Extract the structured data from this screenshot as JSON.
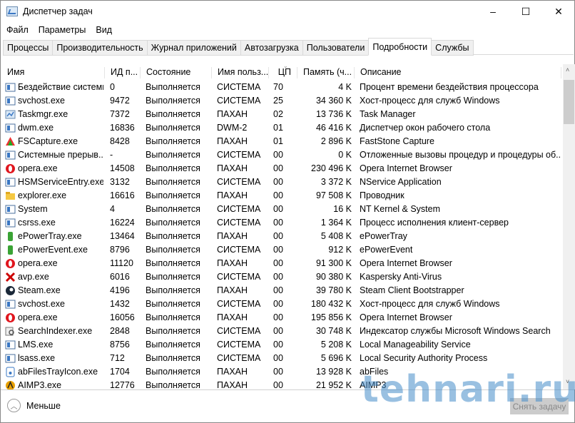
{
  "window": {
    "title": "Диспетчер задач",
    "minimize": "–",
    "maximize": "☐",
    "close": "✕"
  },
  "menu": [
    "Файл",
    "Параметры",
    "Вид"
  ],
  "tabs": [
    "Процессы",
    "Производительность",
    "Журнал приложений",
    "Автозагрузка",
    "Пользователи",
    "Подробности",
    "Службы"
  ],
  "active_tab": 5,
  "columns": [
    "Имя",
    "ИД п...",
    "Состояние",
    "Имя польз...",
    "ЦП",
    "Память (ч...",
    "Описание"
  ],
  "rows": [
    [
      "Бездействие системы",
      "0",
      "Выполняется",
      "СИСТЕМА",
      "70",
      "4 K",
      "Процент времени бездействия процессора",
      "win"
    ],
    [
      "svchost.exe",
      "9472",
      "Выполняется",
      "СИСТЕМА",
      "25",
      "34 360 K",
      "Хост-процесс для служб Windows",
      "win"
    ],
    [
      "Taskmgr.exe",
      "7372",
      "Выполняется",
      "ПАХАН",
      "02",
      "13 736 K",
      "Task Manager",
      "tm"
    ],
    [
      "dwm.exe",
      "16836",
      "Выполняется",
      "DWM-2",
      "01",
      "46 416 K",
      "Диспетчер окон рабочего стола",
      "win"
    ],
    [
      "FSCapture.exe",
      "8428",
      "Выполняется",
      "ПАХАН",
      "01",
      "2 896 K",
      "FastStone Capture",
      "fs"
    ],
    [
      "Системные прерыв...",
      "-",
      "Выполняется",
      "СИСТЕМА",
      "00",
      "0 K",
      "Отложенные вызовы процедур и процедуры об...",
      "win"
    ],
    [
      "opera.exe",
      "14508",
      "Выполняется",
      "ПАХАН",
      "00",
      "230 496 K",
      "Opera Internet Browser",
      "opera"
    ],
    [
      "HSMServiceEntry.exe",
      "3132",
      "Выполняется",
      "СИСТЕМА",
      "00",
      "3 372 K",
      "NService Application",
      "win"
    ],
    [
      "explorer.exe",
      "16616",
      "Выполняется",
      "ПАХАН",
      "00",
      "97 508 K",
      "Проводник",
      "folder"
    ],
    [
      "System",
      "4",
      "Выполняется",
      "СИСТЕМА",
      "00",
      "16 K",
      "NT Kernel & System",
      "win"
    ],
    [
      "csrss.exe",
      "16224",
      "Выполняется",
      "СИСТЕМА",
      "00",
      "1 364 K",
      "Процесс исполнения клиент-сервер",
      "win"
    ],
    [
      "ePowerTray.exe",
      "13464",
      "Выполняется",
      "ПАХАН",
      "00",
      "5 408 K",
      "ePowerTray",
      "green"
    ],
    [
      "ePowerEvent.exe",
      "8796",
      "Выполняется",
      "СИСТЕМА",
      "00",
      "912 K",
      "ePowerEvent",
      "green"
    ],
    [
      "opera.exe",
      "11120",
      "Выполняется",
      "ПАХАН",
      "00",
      "91 300 K",
      "Opera Internet Browser",
      "opera"
    ],
    [
      "avp.exe",
      "6016",
      "Выполняется",
      "СИСТЕМА",
      "00",
      "90 380 K",
      "Kaspersky Anti-Virus",
      "avp"
    ],
    [
      "Steam.exe",
      "4196",
      "Выполняется",
      "ПАХАН",
      "00",
      "39 780 K",
      "Steam Client Bootstrapper",
      "steam"
    ],
    [
      "svchost.exe",
      "1432",
      "Выполняется",
      "СИСТЕМА",
      "00",
      "180 432 K",
      "Хост-процесс для служб Windows",
      "win"
    ],
    [
      "opera.exe",
      "16056",
      "Выполняется",
      "ПАХАН",
      "00",
      "195 856 K",
      "Opera Internet Browser",
      "opera"
    ],
    [
      "SearchIndexer.exe",
      "2848",
      "Выполняется",
      "СИСТЕМА",
      "00",
      "30 748 K",
      "Индексатор службы Microsoft Windows Search",
      "search"
    ],
    [
      "LMS.exe",
      "8756",
      "Выполняется",
      "СИСТЕМА",
      "00",
      "5 208 K",
      "Local Manageability Service",
      "win"
    ],
    [
      "lsass.exe",
      "712",
      "Выполняется",
      "СИСТЕМА",
      "00",
      "5 696 K",
      "Local Security Authority Process",
      "win"
    ],
    [
      "abFilesTrayIcon.exe",
      "1704",
      "Выполняется",
      "ПАХАН",
      "00",
      "13 928 K",
      "abFiles",
      "ab"
    ],
    [
      "AIMP3.exe",
      "12776",
      "Выполняется",
      "ПАХАН",
      "00",
      "21 952 K",
      "AIMP3",
      "aimp"
    ]
  ],
  "footer": {
    "less": "Меньше",
    "end_task": "Снять задачу"
  },
  "watermark": "tehnari.ru"
}
